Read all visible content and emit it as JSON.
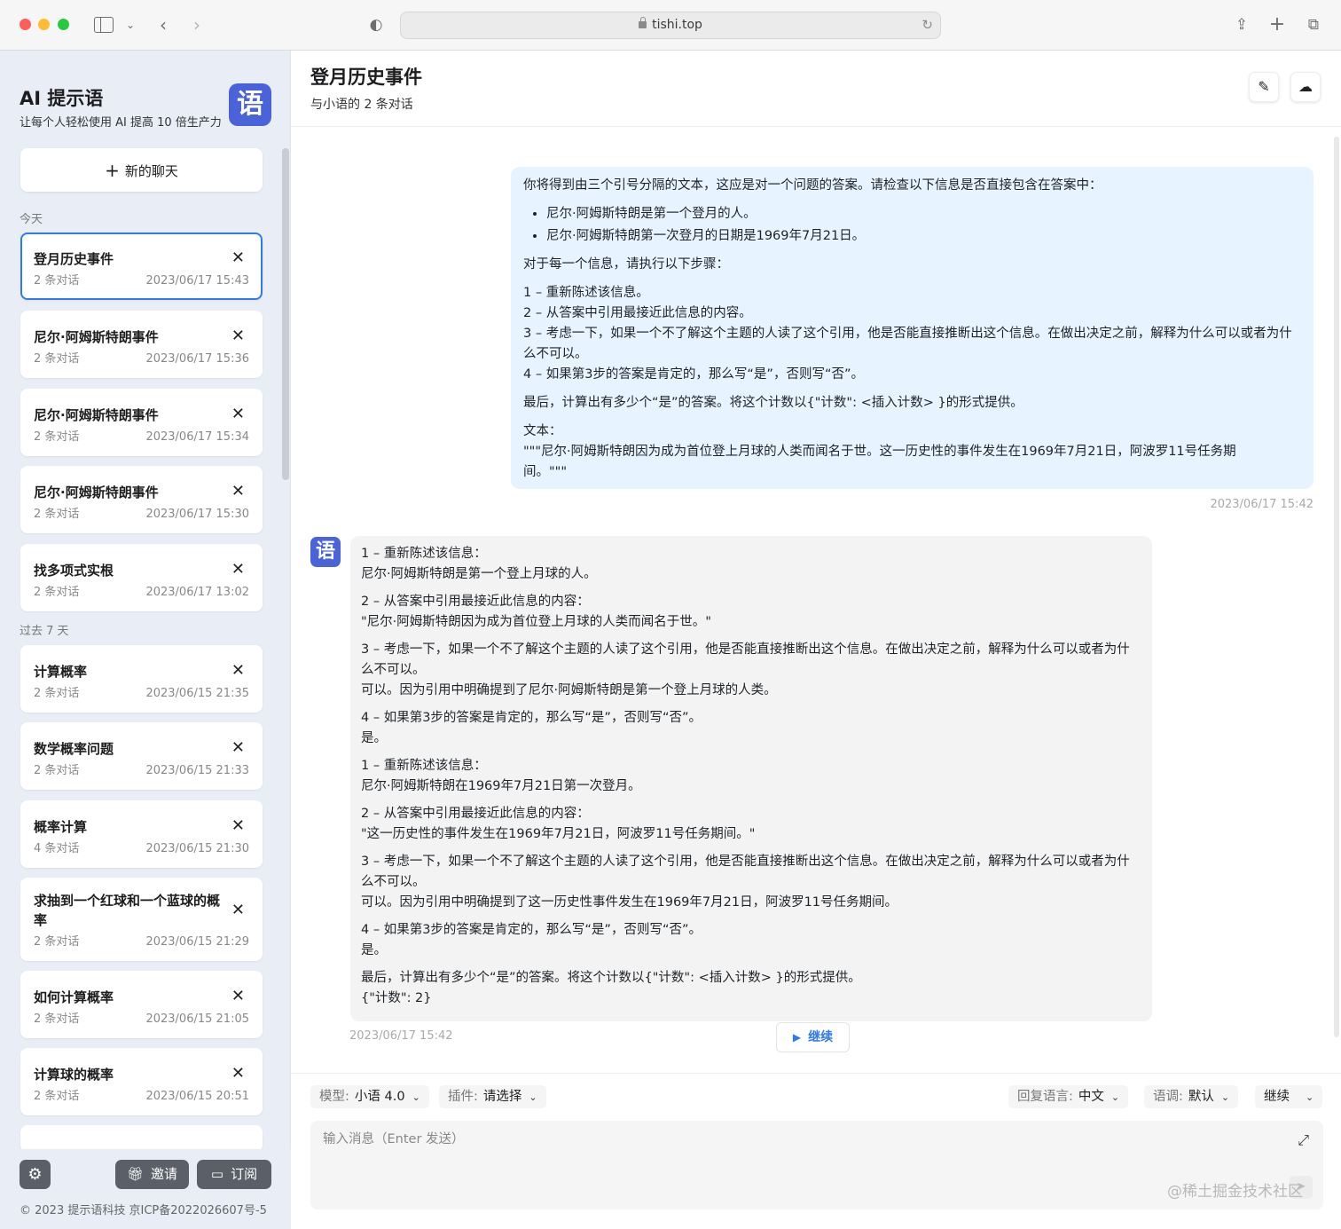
{
  "browser": {
    "url": "tishi.top"
  },
  "sidebar": {
    "brand_title": "AI 提示语",
    "brand_subtitle": "让每个人轻松使用 AI 提高 10 倍生产力",
    "logo_glyph": "语",
    "new_chat_label": "新的聊天",
    "section_today": "今天",
    "section_week": "过去 7 天",
    "today_items": [
      {
        "title": "登月历史事件",
        "count": "2 条对话",
        "time": "2023/06/17 15:43"
      },
      {
        "title": "尼尔·阿姆斯特朗事件",
        "count": "2 条对话",
        "time": "2023/06/17 15:36"
      },
      {
        "title": "尼尔·阿姆斯特朗事件",
        "count": "2 条对话",
        "time": "2023/06/17 15:34"
      },
      {
        "title": "尼尔·阿姆斯特朗事件",
        "count": "2 条对话",
        "time": "2023/06/17 15:30"
      },
      {
        "title": "找多项式实根",
        "count": "2 条对话",
        "time": "2023/06/17 13:02"
      }
    ],
    "week_items": [
      {
        "title": "计算概率",
        "count": "2 条对话",
        "time": "2023/06/15 21:35"
      },
      {
        "title": "数学概率问题",
        "count": "2 条对话",
        "time": "2023/06/15 21:33"
      },
      {
        "title": "概率计算",
        "count": "4 条对话",
        "time": "2023/06/15 21:30"
      },
      {
        "title": "求抽到一个红球和一个蓝球的概率",
        "count": "2 条对话",
        "time": "2023/06/15 21:29"
      },
      {
        "title": "如何计算概率",
        "count": "2 条对话",
        "time": "2023/06/15 21:05"
      },
      {
        "title": "计算球的概率",
        "count": "2 条对话",
        "time": "2023/06/15 20:51"
      }
    ],
    "close_glyph": "✕",
    "invite_label": "邀请",
    "subscribe_label": "订阅",
    "copyright": "© 2023 提示语科技 京ICP备2022026607号-5"
  },
  "main": {
    "title": "登月历史事件",
    "subtitle": "与小语的 2 条对话",
    "user_message": {
      "intro": "你将得到由三个引号分隔的文本，这应是对一个问题的答案。请检查以下信息是否直接包含在答案中：",
      "bullets": [
        "尼尔·阿姆斯特朗是第一个登月的人。",
        "尼尔·阿姆斯特朗第一次登月的日期是1969年7月21日。"
      ],
      "steps_intro": "对于每一个信息，请执行以下步骤：",
      "steps": [
        "1 – 重新陈述该信息。",
        "2 – 从答案中引用最接近此信息的内容。",
        "3 – 考虑一下，如果一个不了解这个主题的人读了这个引用，他是否能直接推断出这个信息。在做出决定之前，解释为什么可以或者为什么不可以。",
        "4 – 如果第3步的答案是肯定的，那么写“是”，否则写“否”。"
      ],
      "final": "最后，计算出有多少个“是”的答案。将这个计数以{\"计数\": <插入计数> }的形式提供。",
      "text_label": "文本：",
      "text_body": "\"\"\"尼尔·阿姆斯特朗因为成为首位登上月球的人类而闻名于世。这一历史性的事件发生在1969年7月21日，阿波罗11号任务期间。\"\"\"",
      "time": "2023/06/17 15:42"
    },
    "bot_message": {
      "avatar_glyph": "语",
      "blocks": [
        [
          "1 – 重新陈述该信息：",
          "尼尔·阿姆斯特朗是第一个登上月球的人。"
        ],
        [
          "2 – 从答案中引用最接近此信息的内容：",
          "\"尼尔·阿姆斯特朗因为成为首位登上月球的人类而闻名于世。\""
        ],
        [
          "3 – 考虑一下，如果一个不了解这个主题的人读了这个引用，他是否能直接推断出这个信息。在做出决定之前，解释为什么可以或者为什么不可以。",
          "可以。因为引用中明确提到了尼尔·阿姆斯特朗是第一个登上月球的人类。"
        ],
        [
          "4 – 如果第3步的答案是肯定的，那么写“是”，否则写“否”。",
          "是。"
        ],
        [
          "1 – 重新陈述该信息：",
          "尼尔·阿姆斯特朗在1969年7月21日第一次登月。"
        ],
        [
          "2 – 从答案中引用最接近此信息的内容：",
          "\"这一历史性的事件发生在1969年7月21日，阿波罗11号任务期间。\""
        ],
        [
          "3 – 考虑一下，如果一个不了解这个主题的人读了这个引用，他是否能直接推断出这个信息。在做出决定之前，解释为什么可以或者为什么不可以。",
          "可以。因为引用中明确提到了这一历史性事件发生在1969年7月21日，阿波罗11号任务期间。"
        ],
        [
          "4 – 如果第3步的答案是肯定的，那么写“是”，否则写“否”。",
          "是。"
        ],
        [
          "最后，计算出有多少个“是”的答案。将这个计数以{\"计数\": <插入计数> }的形式提供。",
          "{\"计数\": 2}"
        ]
      ],
      "time": "2023/06/17 15:42"
    },
    "continue_label": "继续",
    "controls": {
      "model_key": "模型:",
      "model_value": "小语 4.0",
      "plugin_key": "插件:",
      "plugin_value": "请选择",
      "reply_lang_key": "回复语言:",
      "reply_lang_value": "中文",
      "tone_key": "语调:",
      "tone_value": "默认",
      "mode_value": "继续"
    },
    "input_placeholder": "输入消息（Enter 发送）",
    "watermark": "@稀土掘金技术社区"
  }
}
